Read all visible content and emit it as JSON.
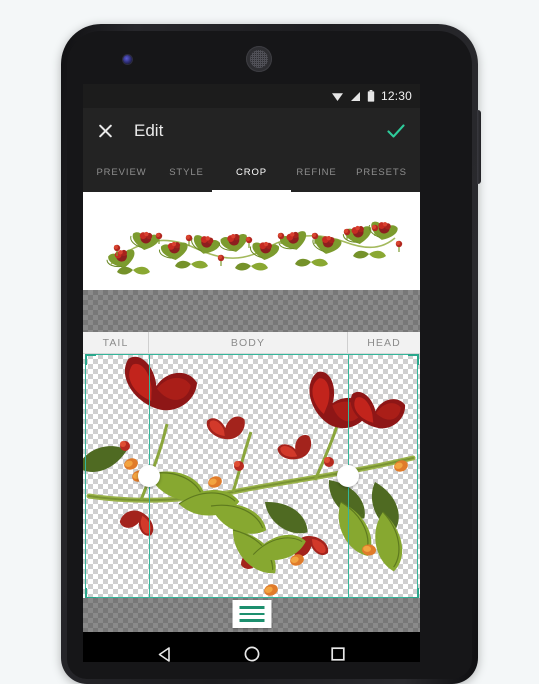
{
  "device": {
    "type": "android-phone",
    "front_camera_icon": "front-camera-icon",
    "earpiece_icon": "earpiece-speaker-icon",
    "power_button": "power-button"
  },
  "status_bar": {
    "wifi_icon": "wifi-icon",
    "signal_icon": "cellular-signal-icon",
    "battery_icon": "battery-icon",
    "clock": "12:30"
  },
  "app_bar": {
    "close_icon": "close-icon",
    "title": "Edit",
    "confirm_icon": "check-icon",
    "confirm_color": "#2ecc9b",
    "background": "#232323"
  },
  "tabs": {
    "items": [
      {
        "label": "PREVIEW",
        "active": false
      },
      {
        "label": "STYLE",
        "active": false
      },
      {
        "label": "CROP",
        "active": true
      },
      {
        "label": "REFINE",
        "active": false
      },
      {
        "label": "PRESETS",
        "active": false
      }
    ],
    "active_index": 2,
    "active_color": "#ffffff",
    "inactive_color": "#8e8e8e"
  },
  "preview": {
    "name": "pattern-preview-strip",
    "background": "#ffffff",
    "description": "Repeating floral vine border pattern preview"
  },
  "segments": {
    "items": [
      {
        "label": "TAIL"
      },
      {
        "label": "BODY"
      },
      {
        "label": "HEAD"
      }
    ],
    "bar_background": "#f2f2f2",
    "text_color": "#8c8c8c"
  },
  "crop": {
    "frame_color": "#35b59a",
    "corner_color": "#2aa78c",
    "handle_color": "#ffffff",
    "handles": [
      {
        "name": "crop-handle-tail",
        "position_pct": 19.5
      },
      {
        "name": "crop-handle-head",
        "position_pct": 78.5
      }
    ],
    "checkerboard": "transparent-background",
    "artwork": "Floral vine with red blossoms and green leaves on transparent background"
  },
  "bottom_menu": {
    "name": "layers-menu-button",
    "icon": "hamburger-lines-icon",
    "line_color": "#1d8f6e",
    "background": "#ffffff"
  },
  "nav_bar": {
    "back_icon": "back-triangle-icon",
    "home_icon": "home-circle-icon",
    "recents_icon": "recents-square-icon",
    "background": "#000000"
  }
}
